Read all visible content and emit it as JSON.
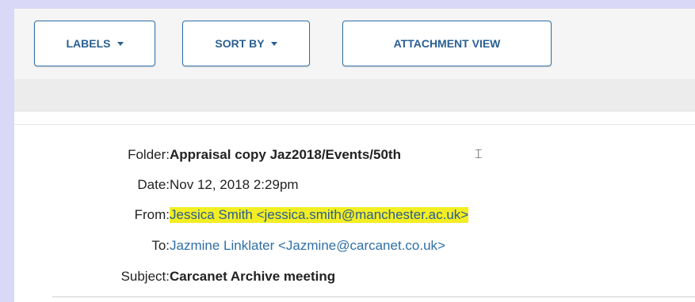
{
  "toolbar": {
    "labels_button": "LABELS",
    "sort_button": "SORT BY",
    "attachment_button": "ATTACHMENT VIEW"
  },
  "email": {
    "folder_label": "Folder:",
    "folder_value": "Appraisal copy Jaz2018/Events/50th",
    "date_label": "Date:",
    "date_value": "Nov 12, 2018 2:29pm",
    "from_label": "From:",
    "from_value": "Jessica Smith <jessica.smith@manchester.ac.uk>",
    "to_label": "To:",
    "to_value": "Jazmine Linklater <Jazmine@carcanet.co.uk>",
    "subject_label": "Subject:",
    "subject_value": "Carcanet Archive meeting"
  },
  "colors": {
    "button_text": "#2a5f92",
    "highlight": "#f3ee23",
    "frame": "#d9d8f7"
  }
}
